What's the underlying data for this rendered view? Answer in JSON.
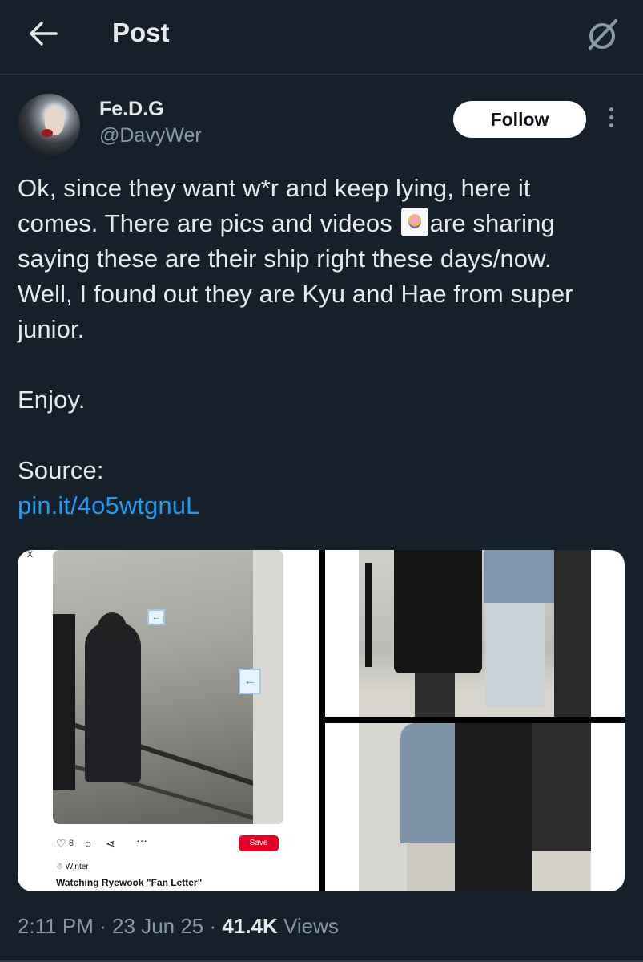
{
  "header": {
    "title": "Post",
    "back_icon": "arrow-left-icon",
    "grok_icon": "grok-icon"
  },
  "author": {
    "name": "Fe.D.G",
    "handle": "@DavyWer",
    "follow_label": "Follow"
  },
  "post": {
    "text_line1": "Ok, since they want w*r and keep lying, here it",
    "text_line2a": "comes. There are pics and videos",
    "text_line2b": "are sharing",
    "text_line3": "saying these are their ship right these days/now.",
    "text_line4": "Well, I found out they are Kyu and Hae from super",
    "text_line5": "junior.",
    "enjoy": "Enjoy.",
    "source_label": "Source:",
    "source_link": "pin.it/4o5wtgnuL"
  },
  "media": {
    "pin": {
      "like_count": "8",
      "save_label": "Save",
      "user": "Winter",
      "caption": "Watching Ryewook \"Fan Letter\"",
      "close": "x"
    }
  },
  "meta": {
    "time": "2:11 PM",
    "sep": "·",
    "date": "23 Jun 25",
    "views_count": "41.4K",
    "views_label": "Views"
  }
}
